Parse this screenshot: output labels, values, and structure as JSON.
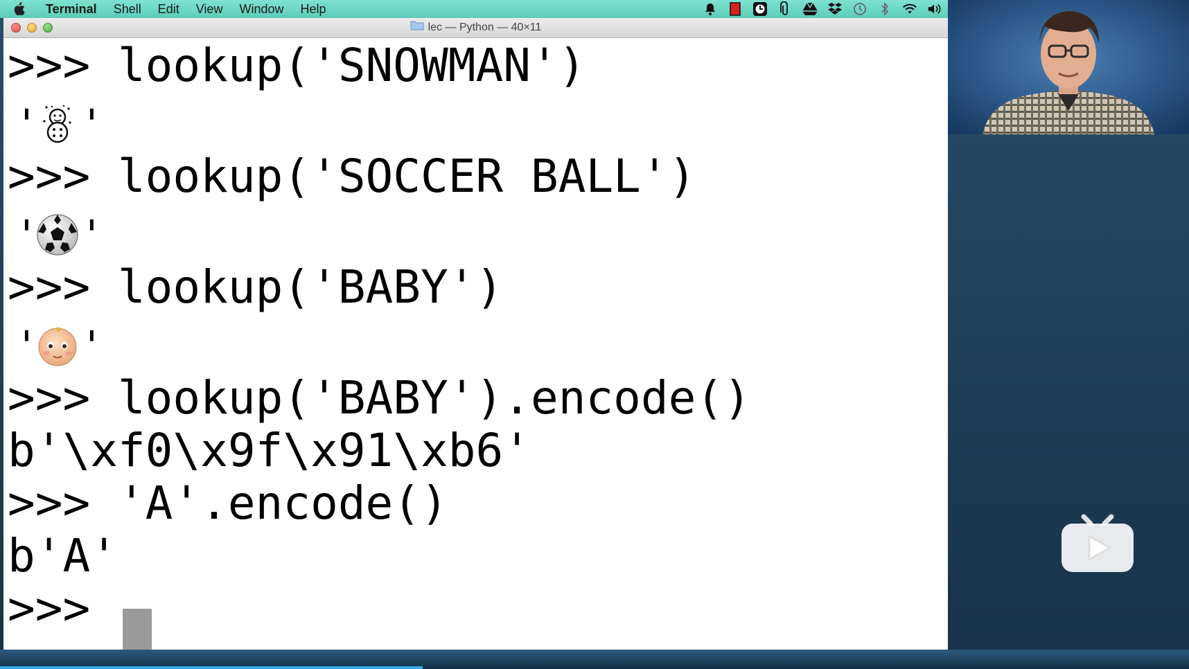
{
  "menubar": {
    "app_name": "Terminal",
    "items": [
      "Shell",
      "Edit",
      "View",
      "Window",
      "Help"
    ],
    "status_icons": [
      "bell-icon",
      "red-square-icon",
      "timer-icon",
      "paperclip-icon",
      "drive-icon",
      "dropbox-icon",
      "time-machine-icon",
      "bluetooth-icon",
      "wifi-icon",
      "volume-icon"
    ]
  },
  "window": {
    "title": "lec — Python — 40×11"
  },
  "terminal": {
    "lines": [
      ">>> lookup('SNOWMAN')",
      ">>> lookup('SOCCER BALL')",
      ">>> lookup('BABY')",
      ">>> lookup('BABY').encode()",
      "b'\\xf0\\x9f\\x91\\xb6'",
      ">>> 'A'.encode()",
      "b'A'",
      ">>> "
    ],
    "outputs": [
      {
        "quote_open": "'",
        "emoji": "snowman-emoji",
        "quote_close": "'"
      },
      {
        "quote_open": "'",
        "emoji": "soccer-ball-emoji",
        "quote_close": "'"
      },
      {
        "quote_open": "'",
        "emoji": "baby-emoji",
        "quote_close": "'"
      }
    ]
  },
  "colors": {
    "menubar": "#5ccdb8",
    "terminal_bg": "#ffffff",
    "terminal_fg": "#000000",
    "cursor": "#9a9a9a"
  }
}
